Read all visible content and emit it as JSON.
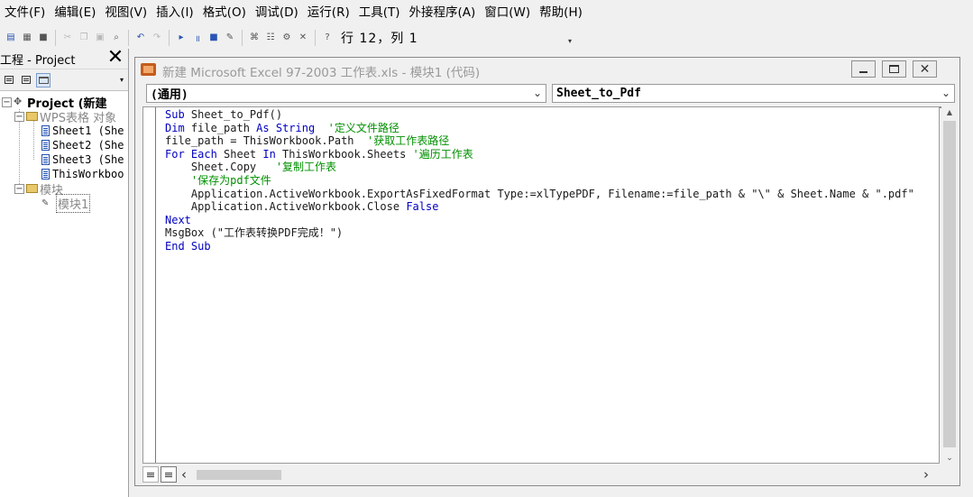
{
  "menu": [
    "文件(F)",
    "编辑(E)",
    "视图(V)",
    "插入(I)",
    "格式(O)",
    "调试(D)",
    "运行(R)",
    "工具(T)",
    "外接程序(A)",
    "窗口(W)",
    "帮助(H)"
  ],
  "toolbar": {
    "cursor_position": "行 12，列 1",
    "icons": [
      "view-excel-icon",
      "insert-module-icon",
      "save-icon",
      "cut-icon",
      "copy-icon",
      "paste-icon",
      "find-icon",
      "undo-icon",
      "redo-icon",
      "run-icon",
      "break-icon",
      "reset-icon",
      "design-mode-icon",
      "project-explorer-icon",
      "properties-icon",
      "object-browser-icon",
      "toolbox-icon",
      "help-icon"
    ]
  },
  "project_panel": {
    "title": "工程 - Project",
    "tree": {
      "project": "Project  (新建",
      "folder_objects": "WPS表格  对象",
      "sheet1": "Sheet1  (She",
      "sheet2": "Sheet2  (She",
      "sheet3": "Sheet3  (She",
      "this_workbook": "ThisWorkboo",
      "folder_modules": "模块",
      "module1": "模块1"
    }
  },
  "code_window": {
    "title": "新建 Microsoft Excel 97-2003 工作表.xls - 模块1 (代码)",
    "object_combo": "(通用)",
    "procedure_combo": "Sheet_to_Pdf",
    "code": [
      [
        [
          "Sub",
          "kw"
        ],
        [
          " Sheet_to_Pdf()",
          ""
        ]
      ],
      [
        [
          "Dim",
          "kw"
        ],
        [
          " file_path ",
          ""
        ],
        [
          "As String",
          "kw"
        ],
        [
          "  '定义文件路径",
          "cm"
        ]
      ],
      [
        [
          "file_path = ThisWorkbook.Path  ",
          ""
        ],
        [
          "'获取工作表路径",
          "cm"
        ]
      ],
      [
        [
          "For Each",
          "kw"
        ],
        [
          " Sheet ",
          ""
        ],
        [
          "In",
          "kw"
        ],
        [
          " ThisWorkbook.Sheets ",
          ""
        ],
        [
          "'遍历工作表",
          "cm"
        ]
      ],
      [
        [
          "    Sheet.Copy   ",
          ""
        ],
        [
          "'复制工作表",
          "cm"
        ]
      ],
      [
        [
          "    '保存为pdf文件",
          "cm"
        ]
      ],
      [
        [
          "    Application.ActiveWorkbook.ExportAsFixedFormat Type:=xlTypePDF, Filename:=file_path & \"\\\" & Sheet.Name & \".pdf\"",
          ""
        ]
      ],
      [
        [
          "    Application.ActiveWorkbook.Close ",
          ""
        ],
        [
          "False",
          "kw"
        ]
      ],
      [
        [
          "Next",
          "kw"
        ]
      ],
      [
        [
          "MsgBox (\"工作表转换PDF完成！\")",
          ""
        ]
      ],
      [
        [
          "End Sub",
          "kw"
        ]
      ]
    ]
  },
  "colors": {
    "keyword": "#0000c0",
    "comment": "#009000",
    "text": "#1a1a1a"
  }
}
